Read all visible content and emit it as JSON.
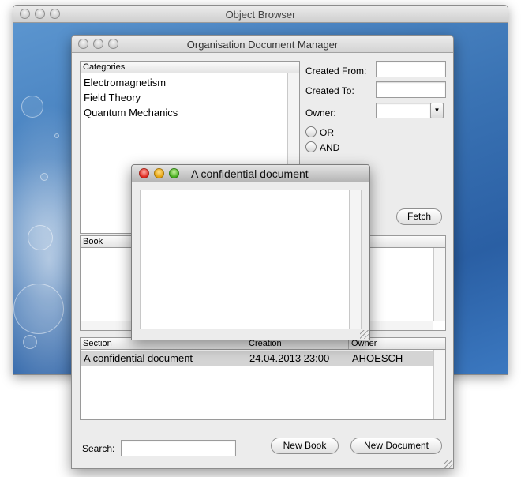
{
  "object_browser": {
    "title": "Object Browser"
  },
  "odm": {
    "title": "Organisation Document Manager",
    "categories": {
      "header": "Categories",
      "items": [
        "Electromagnetism",
        "Field Theory",
        "Quantum Mechanics"
      ]
    },
    "filters": {
      "created_from_label": "Created From:",
      "created_from_value": "",
      "created_to_label": "Created To:",
      "created_to_value": "",
      "owner_label": "Owner:",
      "owner_value": "",
      "or_label": "OR",
      "and_label": "AND",
      "fetch_label": "Fetch"
    },
    "book": {
      "header": "Book"
    },
    "section_table": {
      "columns": [
        "Section",
        "Creation",
        "Owner"
      ],
      "rows": [
        {
          "section": "A confidential document",
          "creation": "24.04.2013 23:00",
          "owner": "AHOESCH"
        }
      ]
    },
    "search_label": "Search:",
    "search_value": "",
    "new_book_label": "New Book",
    "new_document_label": "New Document"
  },
  "document_window": {
    "title": "A confidential document",
    "body_text": ""
  },
  "icons": {
    "combo_arrow": "chevron-down-icon",
    "resize_grip": "resize-grip-icon"
  }
}
